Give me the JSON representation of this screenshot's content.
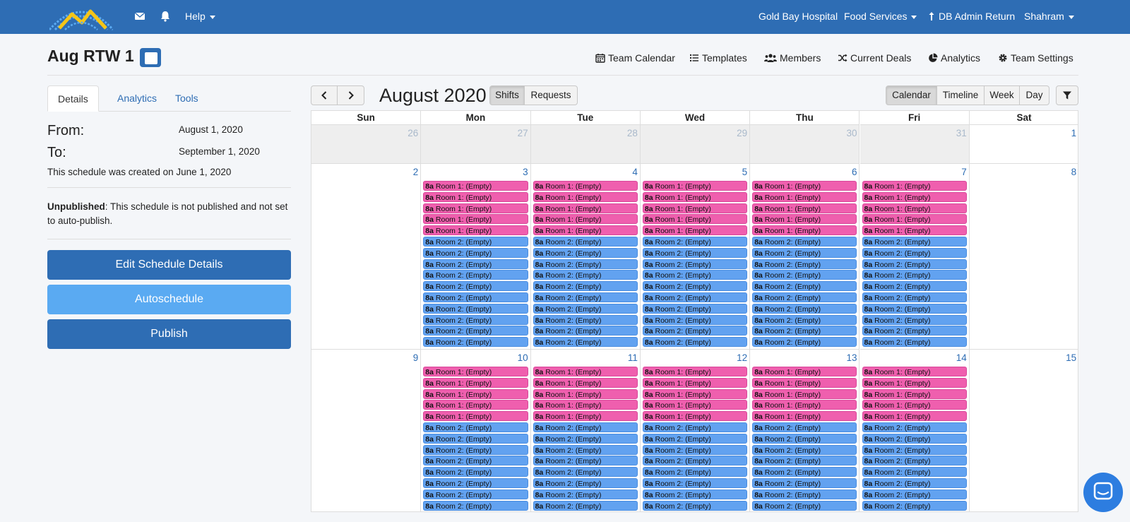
{
  "nav": {
    "help": "Help",
    "hospital": "Gold Bay Hospital",
    "department": "Food Services",
    "admin_return": "DB Admin Return",
    "user": "Shahram"
  },
  "header": {
    "title": "Aug RTW 1",
    "links": {
      "team_calendar": "Team Calendar",
      "templates": "Templates",
      "members": "Members",
      "current_deals": "Current Deals",
      "analytics": "Analytics",
      "team_settings": "Team Settings"
    }
  },
  "left": {
    "tabs": [
      "Details",
      "Analytics",
      "Tools"
    ],
    "from_label": "From:",
    "from_value": "August 1, 2020",
    "to_label": "To:",
    "to_value": "September 1, 2020",
    "created": "This schedule was created on June 1, 2020",
    "status_label": "Unpublished",
    "status_text": ": This schedule is not published and not set to auto-publish.",
    "edit_button": "Edit Schedule Details",
    "autoschedule_button": "Autoschedule",
    "publish_button": "Publish"
  },
  "calendar": {
    "title": "August 2020",
    "mode_shifts": "Shifts",
    "mode_requests": "Requests",
    "views": [
      "Calendar",
      "Timeline",
      "Week",
      "Day"
    ],
    "weekdays": [
      "Sun",
      "Mon",
      "Tue",
      "Wed",
      "Thu",
      "Fri",
      "Sat"
    ],
    "weeks": [
      [
        "26",
        "27",
        "28",
        "29",
        "30",
        "31",
        "1"
      ],
      [
        "2",
        "3",
        "4",
        "5",
        "6",
        "7",
        "8"
      ],
      [
        "9",
        "10",
        "11",
        "12",
        "13",
        "14",
        "15"
      ]
    ],
    "event_time": "8a",
    "room1_label": "Room 1: (Empty)",
    "room2_label": "Room 2: (Empty)",
    "room1_count": 5,
    "room2_count": 10
  },
  "colors": {
    "brand": "#2e6db4",
    "room1": "#ef5fae",
    "room2": "#62a2f0"
  }
}
